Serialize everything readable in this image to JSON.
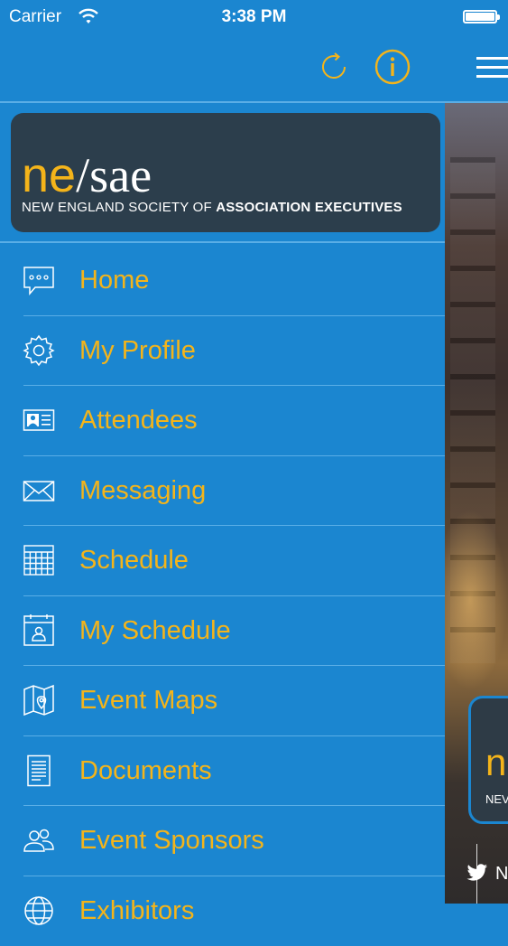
{
  "status_bar": {
    "carrier": "Carrier",
    "time": "3:38 PM"
  },
  "toolbar": {
    "refresh_icon": "refresh-icon",
    "info_icon": "info-icon",
    "menu_icon": "hamburger-menu-icon"
  },
  "logo": {
    "ne": "ne",
    "slash": "/",
    "sae": "sae",
    "tagline_regular": "NEW ENGLAND SOCIETY OF ",
    "tagline_bold": "ASSOCIATION EXECUTIVES"
  },
  "menu": {
    "items": [
      {
        "label": "Home",
        "icon": "chat-bubble-icon"
      },
      {
        "label": "My Profile",
        "icon": "gear-icon"
      },
      {
        "label": "Attendees",
        "icon": "id-card-icon"
      },
      {
        "label": "Messaging",
        "icon": "envelope-icon"
      },
      {
        "label": "Schedule",
        "icon": "calendar-icon"
      },
      {
        "label": "My Schedule",
        "icon": "user-calendar-icon"
      },
      {
        "label": "Event Maps",
        "icon": "map-icon"
      },
      {
        "label": "Documents",
        "icon": "document-icon"
      },
      {
        "label": "Event Sponsors",
        "icon": "people-icon"
      },
      {
        "label": "Exhibitors",
        "icon": "globe-icon"
      }
    ]
  },
  "background_card": {
    "logo_fragment": "n",
    "text_fragment": "NEV",
    "twitter_fragment": "N"
  },
  "colors": {
    "background": "#1b86d0",
    "accent_yellow": "#f4b41a",
    "logo_card": "#2c3e4c",
    "divider": "#5aaee6"
  }
}
